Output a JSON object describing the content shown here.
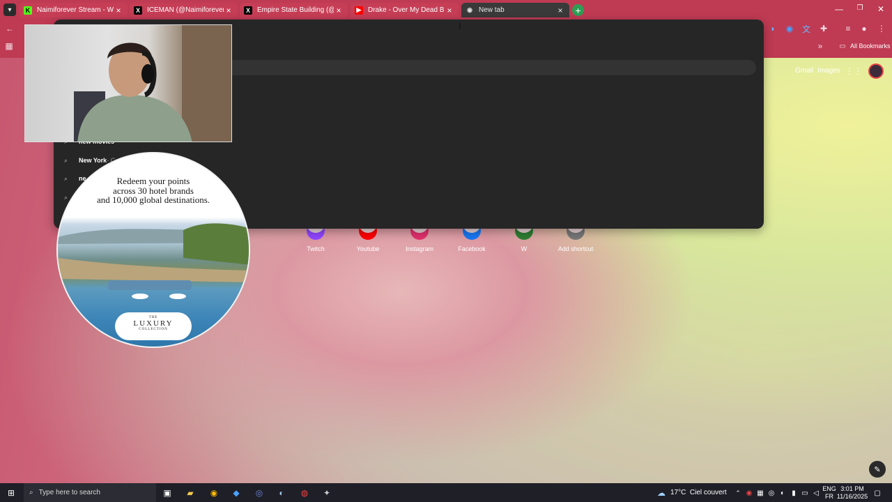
{
  "tabs": [
    {
      "title": "Naimiforever Stream - Watch L",
      "icon": "kick-icon",
      "icon_char": "K",
      "icon_bg": "#53fc18",
      "icon_fg": "#000000",
      "bg": "#c63e56"
    },
    {
      "title": "ICEMAN (@Naimiforever) / X",
      "icon": "x-icon",
      "icon_char": "X",
      "icon_bg": "#000000",
      "icon_fg": "#ffffff",
      "bg": "#c63e56"
    },
    {
      "title": "Empire State Building (@Empi",
      "icon": "x-icon",
      "icon_char": "X",
      "icon_bg": "#000000",
      "icon_fg": "#ffffff",
      "bg": "#c63e56"
    },
    {
      "title": "Drake - Over My Dead Body (S",
      "icon": "youtube-icon",
      "icon_char": "▶",
      "icon_bg": "#ff0000",
      "icon_fg": "#ffffff",
      "bg": "#c63e56"
    },
    {
      "title": "New tab",
      "icon": "chrome-icon",
      "icon_char": "◉",
      "icon_bg": "transparent",
      "icon_fg": "#dddddd",
      "bg": "#3a3a3a"
    }
  ],
  "toolbar": {
    "all_bookmarks": "All Bookmarks"
  },
  "omnibox": {
    "suggestions": [
      {
        "bold": "new movies",
        "rest": ""
      },
      {
        "bold": "New York",
        "rest": " - C"
      },
      {
        "bold": "ne",
        "rest": ""
      },
      {
        "bold": "",
        "rest": ""
      }
    ]
  },
  "header": {
    "gmail": "Gmail",
    "images": "Images"
  },
  "shortcuts": [
    {
      "label": "Twitch",
      "color": "#9146ff"
    },
    {
      "label": "Youtube",
      "color": "#ff0000"
    },
    {
      "label": "Instagram",
      "color": "#e1306c"
    },
    {
      "label": "Facebook",
      "color": "#1877f2"
    },
    {
      "label": "W",
      "color": "#2e7d32"
    },
    {
      "label": "Add shortcut",
      "color": "#777777"
    }
  ],
  "ad": {
    "line1": "Redeem your points",
    "line2": "across 30 hotel brands",
    "line3": "and 10,000 global destinations.",
    "logo_top": "THE",
    "logo_main": "LUXURY",
    "logo_bottom": "COLLECTION"
  },
  "taskbar": {
    "search_placeholder": "Type here to search",
    "weather": "17°C  Ciel couvert",
    "lang_top": "ENG",
    "lang_bottom": "FR",
    "time": "3:01 PM",
    "date": "11/16/2025"
  }
}
